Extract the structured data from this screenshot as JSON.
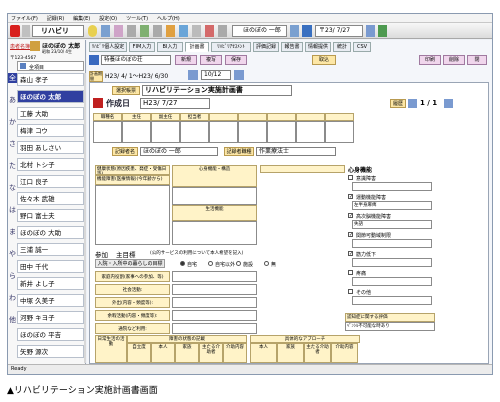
{
  "menu": [
    "ファイル(F)",
    "記録(R)",
    "編集(E)",
    "設定(O)",
    "ツール(T)",
    "ヘルプ(H)"
  ],
  "toolbar": {
    "app_name": "リハビリ",
    "patient_name": "ほのぼの 一郎",
    "date": "H23/ 7/27",
    "date_combo": "〒23/ 7/27"
  },
  "nav": {
    "header_left": "患者名簿",
    "header_name": "ほのぼの 太郎",
    "line1": "昭和 23/10/ 4生",
    "line2": "〒123-4567",
    "search_label": "全項目",
    "kana": [
      "全",
      "あ",
      "か",
      "さ",
      "た",
      "な",
      "は",
      "ま",
      "や",
      "ら",
      "わ",
      "他"
    ],
    "patients": [
      "森山 孝子",
      "ほのぼの 太郎",
      "工藤 大助",
      "梅津 コウ",
      "羽田 あしさい",
      "北村 トシ子",
      "江口 良子",
      "佐々木 武雄",
      "野口 富士夫",
      "ほのぼの 大助",
      "三浦 誠一",
      "田中 千代",
      "新井 よし子",
      "中塚 久美子",
      "河野 キヨ子",
      "ほのぼの 平吉",
      "矢野 源次"
    ],
    "selected_index": 1
  },
  "tabs": [
    "ﾘﾊﾋﾞﾘ個人設定",
    "FIM入力",
    "BI入力",
    "計画書",
    "ﾘﾊﾋﾞﾘｱｾｽﾒﾝﾄ",
    "評価記録",
    "報告書",
    "情報提供",
    "統計",
    "CSV"
  ],
  "active_tab": 3,
  "form": {
    "template_label": "特養ほのぼの荘",
    "btn_new": "新規",
    "btn_copy": "複写",
    "btn_save": "保存",
    "btn_takein": "取込",
    "btn_print": "印刷",
    "btn_delete": "削除",
    "btn_close": "閉",
    "period_label": "計画期間",
    "period": "H23/ 4/ 1〜H23/ 6/30",
    "eval_date": "10/12",
    "form_type_label": "選択帳票",
    "form_type": "リハビリテーション実施計画書",
    "created_label": "作成日",
    "created": "H23/ 7/27",
    "history_label": "履歴",
    "page": "1 / 1",
    "signers": [
      "職種名",
      "主任",
      "副主任",
      "担当者"
    ],
    "doctor_label": "記録者名",
    "doctor": "ほのぼの 一郎",
    "facility_label": "記録者職種",
    "facility": "作業療法士"
  },
  "left_block": {
    "h1": "健康状態(原因疾患、発症・受傷日等)",
    "h2": "機能障害(医療情報)(今年齢から)",
    "h3": "心身機能・構造",
    "h4": "生活機能",
    "participation_label": "参加",
    "main_label": "主目標",
    "note": "(公的サービスの利用について本人希望を記入)",
    "opt1": "入院・入所中の暮らしの目標",
    "radios": [
      "自宅",
      "自宅以外",
      "施設",
      "無"
    ],
    "rows": [
      "家庭内役割(家事への参加、等)",
      "社会活動:",
      "外出(内容・頻度等):",
      "余暇活動(内容・頻度等):",
      "通院など利用:"
    ]
  },
  "right_block": {
    "title": "心身機能",
    "items": [
      "意識障害",
      "運動機能障害",
      "高次脳機能障害",
      "関節可動域制限",
      "筋力低下",
      "疼痛",
      "その他"
    ],
    "checked": [
      false,
      true,
      true,
      true,
      true,
      false,
      false
    ],
    "values": [
      "",
      "左半身麻痺",
      "失語",
      "",
      "",
      "",
      ""
    ],
    "note_label": "認知症に関する評価",
    "note": "ﾍﾟﾝｼﾙ不可能な時あり"
  },
  "bottom_table": {
    "left_title": "障害の状態の記載",
    "right_title": "具体的なアプローチ",
    "col1": "自立度",
    "cols": [
      "本人",
      "家族",
      "主たる介助者",
      "介助内容"
    ],
    "rows": [
      "自立",
      "見守り",
      "自立"
    ],
    "side": "ﾄｲﾚﾄ",
    "side2": "日常生活の活動"
  },
  "status": "Ready",
  "caption": "▲リハビリテーション実施計画書画面"
}
